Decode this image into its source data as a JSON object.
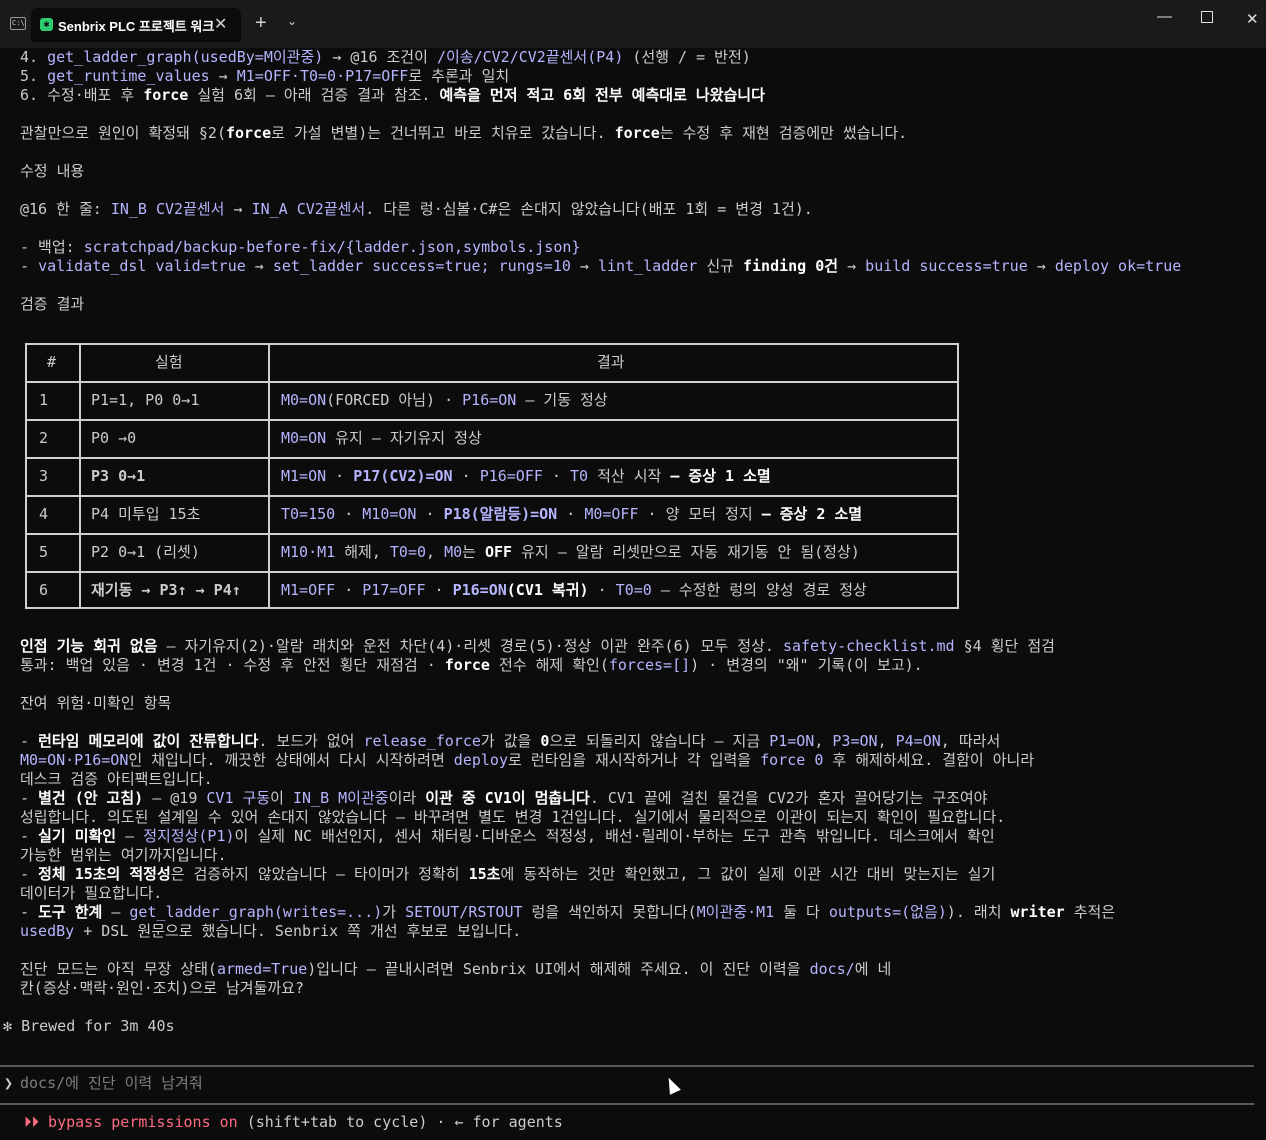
{
  "window": {
    "tab_title": "Senbrix PLC 프로젝트 워크",
    "tab_close": "✕",
    "new_tab": "+",
    "dropdown": "⌄",
    "minimize": "—",
    "close": "✕"
  },
  "top_lines": {
    "l4_num": "4. ",
    "l4_a": "get_ladder_graph(usedBy=M이관중)",
    "l4_b": " → @16 조건이 ",
    "l4_c": "/이송/CV2/CV2끝센서(P4)",
    "l4_d": " (선행 / = 반전)",
    "l5_num": "5. ",
    "l5_a": "get_runtime_values",
    "l5_b": " → ",
    "l5_c": "M1=OFF·T0=0·P17=OFF",
    "l5_d": "로 추론과 일치",
    "l6_a": "6. 수정·배포 후 ",
    "l6_b": "force",
    "l6_c": " 실험 6회 — 아래 검증 결과 참조. ",
    "l6_d": "예측을 먼저 적고 6회 전부 예측대로 나왔습니다",
    "obs_a": "관찰만으로 원인이 확정돼 §2(",
    "obs_b": "force",
    "obs_c": "로 가설 변별)는 건너뛰고 바로 치유로 갔습니다. ",
    "obs_d": "force",
    "obs_e": "는 수정 후 재현 검증에만 썼습니다."
  },
  "fix": {
    "heading": "수정 내용",
    "line_a": "@16 한 줄: ",
    "line_b": "IN_B CV2끝센서",
    "line_c": " → ",
    "line_d": "IN_A CV2끝센서",
    "line_e": ". 다른 렁·심볼·C#은 손대지 않았습니다(배포 1회 = 변경 1건).",
    "backup_a": "- 백업: ",
    "backup_b": "scratchpad/backup-before-fix/{ladder.json,symbols.json}",
    "val_a": "- ",
    "val_b": "validate_dsl valid=true",
    "val_c": " → ",
    "val_d": "set_ladder success=true; rungs=10",
    "val_e": " → ",
    "val_f": "lint_ladder",
    "val_g": " 신규 ",
    "val_h": "finding 0건",
    "val_i": " → ",
    "val_j": "build success=true",
    "val_k": " → ",
    "val_l": "deploy ok=true"
  },
  "verify": {
    "heading": "검증 결과",
    "headers": [
      "#",
      "실험",
      "결과"
    ],
    "rows": [
      {
        "num": "1",
        "exp": "P1=1, P0 0→1",
        "res": [
          {
            "t": "M0=ON",
            "s": "hl"
          },
          {
            "t": "(FORCED 아님) · ",
            "s": ""
          },
          {
            "t": "P16=ON",
            "s": "hl"
          },
          {
            "t": " — 기동 정상",
            "s": ""
          }
        ]
      },
      {
        "num": "2",
        "exp": "P0 →0",
        "res": [
          {
            "t": "M0=ON",
            "s": "hl"
          },
          {
            "t": " 유지 — 자기유지 정상",
            "s": ""
          }
        ]
      },
      {
        "num": "3",
        "exp": "P3 0→1",
        "res": [
          {
            "t": "M1=ON",
            "s": "hl"
          },
          {
            "t": " · ",
            "s": ""
          },
          {
            "t": "P17(CV2)=ON",
            "s": "hlb"
          },
          {
            "t": " · ",
            "s": ""
          },
          {
            "t": "P16=OFF",
            "s": "hl"
          },
          {
            "t": " · ",
            "s": ""
          },
          {
            "t": "T0",
            "s": "hl"
          },
          {
            "t": " 적산 시작 ",
            "s": ""
          },
          {
            "t": "— 증상 1 소멸",
            "s": "b"
          }
        ]
      },
      {
        "num": "4",
        "exp": "P4 미투입 15초",
        "res": [
          {
            "t": "T0=150",
            "s": "hl"
          },
          {
            "t": " · ",
            "s": ""
          },
          {
            "t": "M10=ON",
            "s": "hl"
          },
          {
            "t": " · ",
            "s": ""
          },
          {
            "t": "P18(알람등)=ON",
            "s": "hlb"
          },
          {
            "t": " · ",
            "s": ""
          },
          {
            "t": "M0=OFF",
            "s": "hl"
          },
          {
            "t": " · 양 모터 정지 ",
            "s": ""
          },
          {
            "t": "— 증상 2 소멸",
            "s": "b"
          }
        ]
      },
      {
        "num": "5",
        "exp": "P2 0→1 (리셋)",
        "res": [
          {
            "t": "M10·M1",
            "s": "hl"
          },
          {
            "t": " 해제, ",
            "s": ""
          },
          {
            "t": "T0=0",
            "s": "hl"
          },
          {
            "t": ", ",
            "s": ""
          },
          {
            "t": "M0",
            "s": "hl"
          },
          {
            "t": "는 ",
            "s": ""
          },
          {
            "t": "OFF",
            "s": "b"
          },
          {
            "t": " 유지 — 알람 리셋만으로 자동 재기동 안 됨(정상)",
            "s": ""
          }
        ]
      },
      {
        "num": "6",
        "exp": "재기동 → P3↑ → P4↑",
        "res": [
          {
            "t": "M1=OFF",
            "s": "hl"
          },
          {
            "t": " · ",
            "s": ""
          },
          {
            "t": "P17=OFF",
            "s": "hl"
          },
          {
            "t": " · ",
            "s": ""
          },
          {
            "t": "P16=ON",
            "s": "hlb"
          },
          {
            "t": "(CV1 복귀)",
            "s": "b"
          },
          {
            "t": " · ",
            "s": ""
          },
          {
            "t": "T0=0",
            "s": "hl"
          },
          {
            "t": " — 수정한 렁의 양성 경로 정상",
            "s": ""
          }
        ]
      }
    ]
  },
  "regression": {
    "l1_a": "인접 기능 회귀 없음",
    "l1_b": " — 자기유지(2)·알람 래치와 운전 차단(4)·리셋 경로(5)·정상 이관 완주(6) 모두 정상. ",
    "l1_c": "safety-checklist.md",
    "l1_d": " §4 횡단 점검",
    "l2_a": "통과: 백업 있음 · 변경 1건 · 수정 후 안전 횡단 재점검 · ",
    "l2_b": "force",
    "l2_c": " 전수 해제 확인(",
    "l2_d": "forces=[]",
    "l2_e": ") · 변경의 \"왜\" 기록(이 보고)."
  },
  "risks": {
    "heading": "잔여 위험·미확인 항목",
    "r1_a": "- ",
    "r1_b": "런타임 메모리에 값이 잔류합니다",
    "r1_c": ". 보드가 없어 ",
    "r1_d": "release_force",
    "r1_e": "가 값을 ",
    "r1_f": "0",
    "r1_g": "으로 되돌리지 않습니다 — 지금 ",
    "r1_h": "P1=ON",
    "r1_i": ", ",
    "r1_j": "P3=ON",
    "r1_k": ", ",
    "r1_l": "P4=ON",
    "r1_m": ", 따라서",
    "r2_a": "M0=ON·P16=ON",
    "r2_b": "인 채입니다. 깨끗한 상태에서 다시 시작하려면 ",
    "r2_c": "deploy",
    "r2_d": "로 런타임을 재시작하거나 각 입력을 ",
    "r2_e": "force 0",
    "r2_f": " 후 해제하세요. 결함이 아니라",
    "r3": "데스크 검증 아티팩트입니다.",
    "r4_a": "- ",
    "r4_b": "별건 (안 고침)",
    "r4_c": " — @19 ",
    "r4_d": "CV1 구동",
    "r4_e": "이 ",
    "r4_f": "IN_B M이관중",
    "r4_g": "이라 ",
    "r4_h": "이관 중 CV1이 멈춥니다",
    "r4_i": ". CV1 끝에 걸친 물건을 CV2가 혼자 끌어당기는 구조여야",
    "r5": "성립합니다. 의도된 설계일 수 있어 손대지 않았습니다 — 바꾸려면 별도 변경 1건입니다. 실기에서 물리적으로 이관이 되는지 확인이 필요합니다.",
    "r6_a": "- ",
    "r6_b": "실기 미확인",
    "r6_c": " — ",
    "r6_d": "정지정상(P1)",
    "r6_e": "이 실제 NC 배선인지, 센서 채터링·디바운스 적정성, 배선·릴레이·부하는 도구 관측 밖입니다. 데스크에서 확인",
    "r7": "가능한 범위는 여기까지입니다.",
    "r8_a": "- ",
    "r8_b": "정체 15초의 적정성",
    "r8_c": "은 검증하지 않았습니다 — 타이머가 정확히 ",
    "r8_d": "15초",
    "r8_e": "에 동작하는 것만 확인했고, 그 값이 실제 이관 시간 대비 맞는지는 실기",
    "r9": "데이터가 필요합니다.",
    "r10_a": "- ",
    "r10_b": "도구 한계",
    "r10_c": " — ",
    "r10_d": "get_ladder_graph(writes=...)",
    "r10_e": "가 ",
    "r10_f": "SETOUT/RSTOUT",
    "r10_g": " 렁을 색인하지 못합니다(",
    "r10_h": "M이관중·M1",
    "r10_i": " 둘 다 ",
    "r10_j": "outputs=(없음)",
    "r10_k": "). 래치 ",
    "r10_l": "writer",
    "r10_m": " 추적은",
    "r11_a": "usedBy",
    "r11_b": " + DSL 원문으로 했습니다. Senbrix 쪽 개선 후보로 보입니다."
  },
  "closing": {
    "l1_a": "진단 모드는 아직 무장 상태(",
    "l1_b": "armed=True",
    "l1_c": ")입니다 — 끝내시려면 Senbrix UI에서 해제해 주세요. 이 진단 이력을 ",
    "l1_d": "docs/",
    "l1_e": "에 네",
    "l2": "칸(증상·맥락·원인·조치)으로 남겨둘까요?"
  },
  "status": {
    "spinner": "✻",
    "brewed": "Brewed for 3m 40s"
  },
  "prompt": {
    "chevron": "❯",
    "text": "docs/에 진단 이력 남겨줘"
  },
  "footer": {
    "arrows": "⏵⏵",
    "bypass": "bypass permissions on",
    "hint": " (shift+tab to cycle) · ← for agents"
  },
  "colors": {
    "background": "#0c0c0c",
    "text": "#cccccc",
    "highlight": "#b4b5fe",
    "bypass": "#ff6b81"
  }
}
